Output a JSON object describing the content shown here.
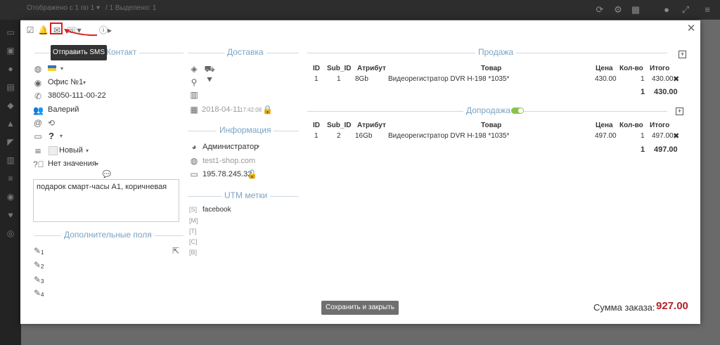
{
  "background": {
    "top_text_1": "Отображено с 1 по 1 ▾",
    "top_text_2": "/ 1 Выделено: 1"
  },
  "toolbar": {
    "tooltip": "Отправить SMS",
    "info_icon_label": "i"
  },
  "contact": {
    "title": "Контакт",
    "office": "Офис №1",
    "phone": "38050-111-00-22",
    "name": "Валерий",
    "unknown": "?",
    "status": "Новый",
    "no_value": "Нет значения",
    "comment": "подарок смарт-часы A1, коричневая"
  },
  "extra_fields": {
    "title": "Дополнительные поля",
    "items": [
      "1",
      "2",
      "3",
      "4"
    ]
  },
  "delivery": {
    "title": "Доставка",
    "date": "2018-04-11",
    "time": "17:42:08"
  },
  "info": {
    "title": "Информация",
    "user": "Администратор",
    "site": "test1-shop.com",
    "ip": "195.78.245.32"
  },
  "utm": {
    "title": "UTM метки",
    "labels": [
      "[S]",
      "[M]",
      "[T]",
      "[C]",
      "[B]"
    ],
    "source_value": "facebook"
  },
  "sale": {
    "title": "Продажа",
    "columns": [
      "ID",
      "Sub_ID",
      "Атрибут",
      "Товар",
      "Цена",
      "Кол-во",
      "Итого"
    ],
    "rows": [
      {
        "id": "1",
        "sub_id": "1",
        "attr": "8Gb",
        "product": "Видеорегистратор DVR H-198 *1035*",
        "price": "430.00",
        "qty": "1",
        "total": "430.00"
      }
    ],
    "sum_qty": "1",
    "sum_total": "430.00"
  },
  "upsell": {
    "title": "Допродажа",
    "columns": [
      "ID",
      "Sub_ID",
      "Атрибут",
      "Товар",
      "Цена",
      "Кол-во",
      "Итого"
    ],
    "rows": [
      {
        "id": "1",
        "sub_id": "2",
        "attr": "16Gb",
        "product": "Видеорегистратор DVR H-198 *1035*",
        "price": "497.00",
        "qty": "1",
        "total": "497.00"
      }
    ],
    "sum_qty": "1",
    "sum_total": "497.00"
  },
  "footer": {
    "save_label": "Сохранить и закрыть",
    "order_sum_label": "Сумма заказа:",
    "order_sum_value": "927.00"
  },
  "colors": {
    "accent_red": "#b0222a",
    "link_blue": "#2a7ab8",
    "section_title": "#7aa3c4",
    "highlight": "#d81e1e"
  }
}
